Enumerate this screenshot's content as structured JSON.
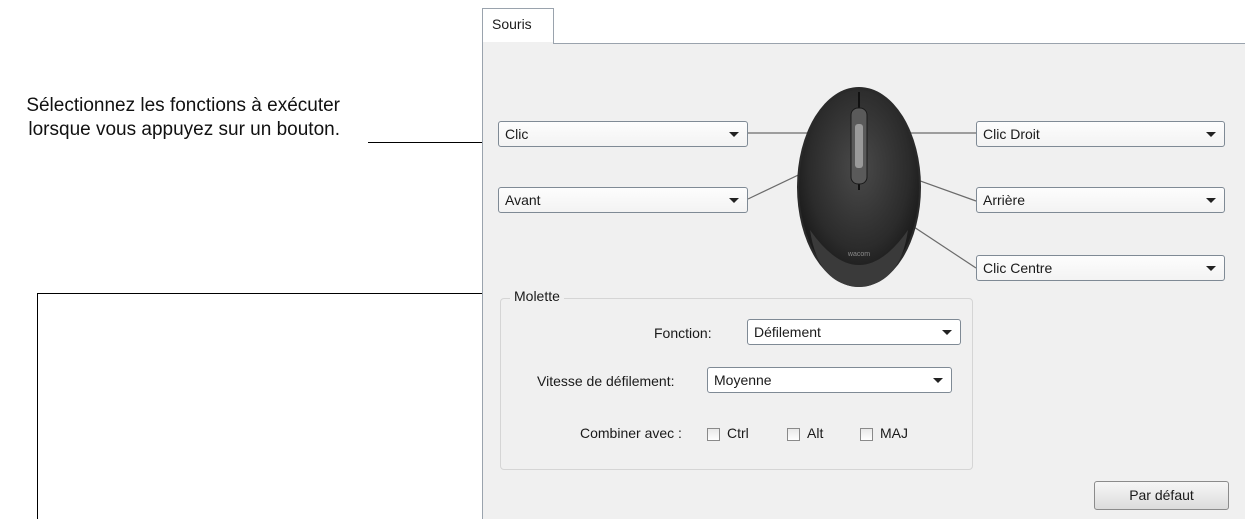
{
  "callout": {
    "line1": "Sélectionnez les fonctions à exécuter",
    "line2": "lorsque vous appuyez sur un bouton."
  },
  "tab": {
    "label": "Souris"
  },
  "buttons_assign": {
    "left_top": "Clic",
    "left_bottom": "Avant",
    "right_top": "Clic Droit",
    "right_middle": "Arrière",
    "right_bottom": "Clic Centre"
  },
  "mouse": {
    "brand": "wacom"
  },
  "molette": {
    "title": "Molette",
    "fonction_label": "Fonction:",
    "fonction_value": "Défilement",
    "vitesse_label": "Vitesse de défilement:",
    "vitesse_value": "Moyenne",
    "combiner_label": "Combiner avec :",
    "modifiers": [
      "Ctrl",
      "Alt",
      "MAJ"
    ]
  },
  "default_button": "Par défaut"
}
